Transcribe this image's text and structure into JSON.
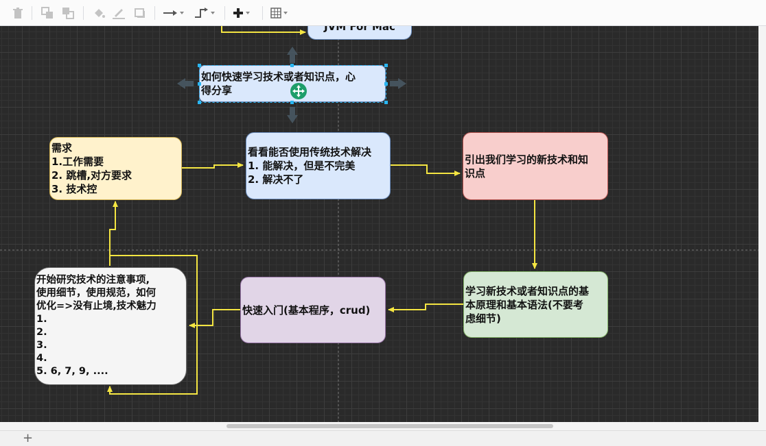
{
  "diagram": {
    "nodes": {
      "jvm": "JVM For Mac",
      "howto": [
        "如何快速学习技术或者知识点，心",
        "得分享"
      ],
      "need": [
        "需求",
        "1.工作需要",
        "2. 跳槽,对方要求",
        "3. 技术控"
      ],
      "traditional": [
        "看看能否使用传统技术解决",
        "1. 能解决，但是不完美",
        "2. 解决不了"
      ],
      "newtech": [
        "引出我们学习的新技术和知",
        "识点"
      ],
      "principle": [
        "学习新技术或者知识点的基",
        "本原理和基本语法(不要考",
        "虑细节)"
      ],
      "quickstart": [
        "快速入门(基本程序，crud)"
      ],
      "research": [
        "开始研究技术的注意事项,",
        "使用细节，使用规范，如何",
        "优化=>没有止境,技术魅力",
        "1.",
        "2.",
        "3.",
        "4.",
        "5. 6, 7, 9, ...."
      ]
    },
    "colors": {
      "arrow": "#f5e642",
      "yellow_fill": "#fff2cc",
      "yellow_border": "#d6b656",
      "blue_fill": "#dae8fc",
      "blue_border": "#6c8ebf",
      "red_fill": "#f8cecc",
      "red_border": "#b85450",
      "green_fill": "#d5e8d4",
      "green_border": "#82b366",
      "purple_fill": "#e1d5e7",
      "purple_border": "#9673a6",
      "gray_fill": "#f5f5f5",
      "gray_border": "#666666",
      "selection": "#29b6f2",
      "move_handle": "#1e9e6a"
    }
  },
  "toolbar": {
    "icons": [
      "delete-icon",
      "to-front-icon",
      "to-back-icon",
      "fill-color-icon",
      "line-color-icon",
      "shadow-icon",
      "connection-icon",
      "waypoints-icon",
      "insert-icon",
      "table-icon"
    ]
  },
  "bottom": {
    "add_page": "+"
  }
}
